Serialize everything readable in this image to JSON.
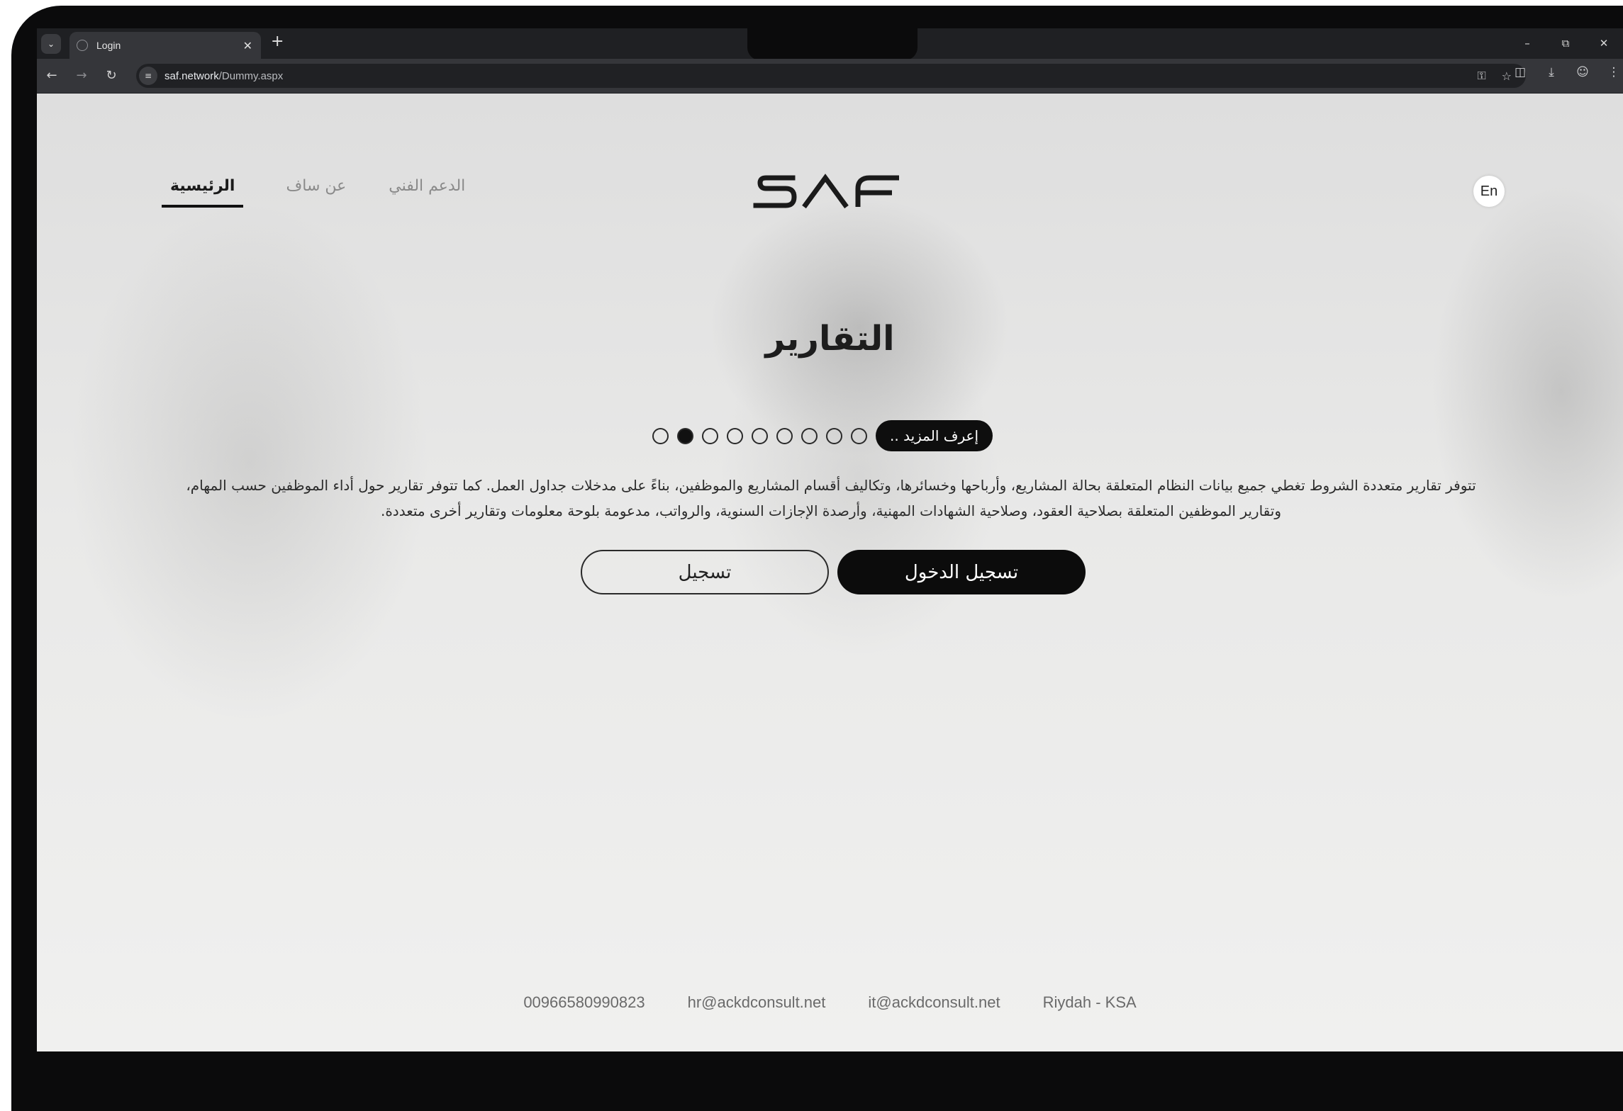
{
  "browser": {
    "tab_title": "Login",
    "url_host": "saf.network",
    "url_path": "/Dummy.aspx"
  },
  "nav": {
    "items": [
      {
        "label": "الرئيسية",
        "active": true
      },
      {
        "label": "عن ساف",
        "active": false
      },
      {
        "label": "الدعم الفني",
        "active": false
      }
    ]
  },
  "logo_text": "SAF",
  "lang_toggle": "En",
  "hero": {
    "title": "التقارير",
    "learn_more": "إعرف المزيد ..",
    "slides_total": 9,
    "active_slide_index": 1,
    "description": "تتوفر تقارير متعددة الشروط تغطي جميع بيانات النظام المتعلقة بحالة المشاريع، وأرباحها وخسائرها، وتكاليف أقسام المشاريع والموظفين، بناءً على مدخلات جداول العمل. كما تتوفر تقارير حول أداء الموظفين حسب المهام، وتقارير الموظفين المتعلقة بصلاحية العقود، وصلاحية الشهادات المهنية، وأرصدة الإجازات السنوية، والرواتب، مدعومة بلوحة معلومات وتقارير أخرى متعددة."
  },
  "buttons": {
    "login": "تسجيل الدخول",
    "register": "تسجيل"
  },
  "footer": {
    "phone": "00966580990823",
    "hr_email": "hr@ackdconsult.net",
    "it_email": "it@ackdconsult.net",
    "location": "Riydah - KSA"
  }
}
